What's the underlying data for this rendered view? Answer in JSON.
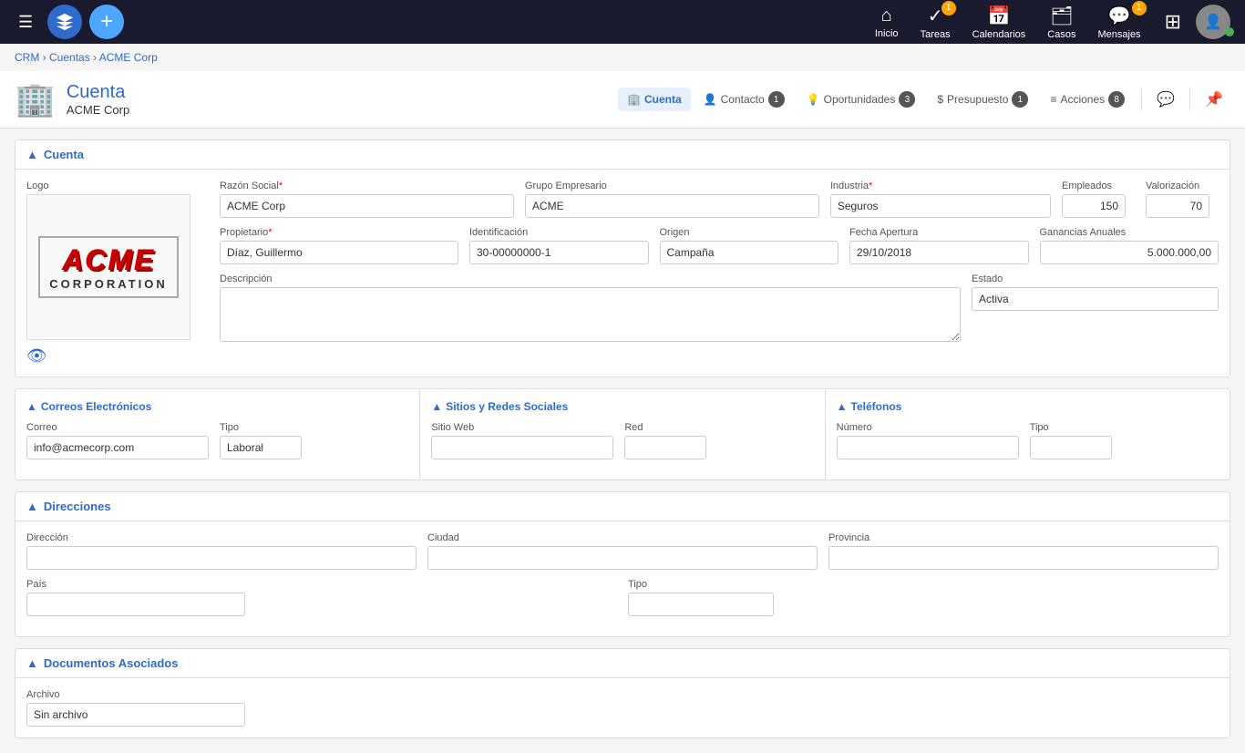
{
  "nav": {
    "hamburger_icon": "☰",
    "logo_icon": "✦",
    "add_icon": "+",
    "items": [
      {
        "id": "inicio",
        "label": "Inicio",
        "icon": "⌂",
        "badge": null
      },
      {
        "id": "tareas",
        "label": "Tareas",
        "icon": "✓",
        "badge": "1"
      },
      {
        "id": "calendarios",
        "label": "Calendarios",
        "icon": "📅",
        "badge": null
      },
      {
        "id": "casos",
        "label": "Casos",
        "icon": "🗂",
        "badge": null
      },
      {
        "id": "mensajes",
        "label": "Mensajes",
        "icon": "💬",
        "badge": "1"
      }
    ],
    "grid_icon": "⊞"
  },
  "breadcrumb": {
    "crm": "CRM",
    "sep1": " › ",
    "cuentas": "Cuentas",
    "sep2": " › ",
    "current": "ACME Corp"
  },
  "page_header": {
    "icon": "🏢",
    "title": "Cuenta",
    "subtitle": "ACME Corp",
    "tabs": [
      {
        "id": "cuenta",
        "label": "Cuenta",
        "count": null,
        "active": true
      },
      {
        "id": "contacto",
        "label": "Contacto",
        "count": "1",
        "active": false
      },
      {
        "id": "oportunidades",
        "label": "Oportunidades",
        "count": "3",
        "active": false
      },
      {
        "id": "presupuesto",
        "label": "Presupuesto",
        "count": "1",
        "active": false
      },
      {
        "id": "acciones",
        "label": "Acciones",
        "count": "8",
        "active": false
      }
    ],
    "chat_icon": "💬",
    "pin_icon": "📌"
  },
  "cuenta_section": {
    "title": "Cuenta",
    "logo_label": "Logo",
    "fields": {
      "razon_social_label": "Razón Social",
      "razon_social_value": "ACME Corp",
      "grupo_empresario_label": "Grupo Empresario",
      "grupo_empresario_value": "ACME",
      "industria_label": "Industria",
      "industria_value": "Seguros",
      "empleados_label": "Empleados",
      "empleados_value": "150",
      "valorizacion_label": "Valorización",
      "valorizacion_value": "70",
      "propietario_label": "Propietario",
      "propietario_value": "Díaz, Guillermo",
      "identificacion_label": "Identificación",
      "identificacion_value": "30-00000000-1",
      "origen_label": "Origen",
      "origen_value": "Campaña",
      "fecha_apertura_label": "Fecha Apertura",
      "fecha_apertura_value": "29/10/2018",
      "ganancias_label": "Ganancias Anuales",
      "ganancias_value": "5.000.000,00",
      "descripcion_label": "Descripción",
      "descripcion_value": "",
      "estado_label": "Estado",
      "estado_value": "Activa"
    }
  },
  "correos_section": {
    "title": "Correos Electrónicos",
    "correo_label": "Correo",
    "correo_value": "info@acmecorp.com",
    "tipo_label": "Tipo",
    "tipo_value": "Laboral"
  },
  "sitios_section": {
    "title": "Sitios y Redes Sociales",
    "sitio_web_label": "Sitio Web",
    "sitio_web_value": "",
    "red_label": "Red",
    "red_value": ""
  },
  "telefonos_section": {
    "title": "Teléfonos",
    "numero_label": "Número",
    "numero_value": "",
    "tipo_label": "Tipo",
    "tipo_value": ""
  },
  "direcciones_section": {
    "title": "Direcciones",
    "direccion_label": "Dirección",
    "direccion_value": "",
    "ciudad_label": "Ciudad",
    "ciudad_value": "",
    "provincia_label": "Provincia",
    "provincia_value": "",
    "pais_label": "País",
    "pais_value": "",
    "tipo_label": "Tipo",
    "tipo_value": ""
  },
  "documentos_section": {
    "title": "Documentos Asociados",
    "archivo_label": "Archivo",
    "archivo_value": "Sin archivo"
  },
  "acme_logo": {
    "line1": "ACME",
    "line2": "CORPORATION"
  }
}
